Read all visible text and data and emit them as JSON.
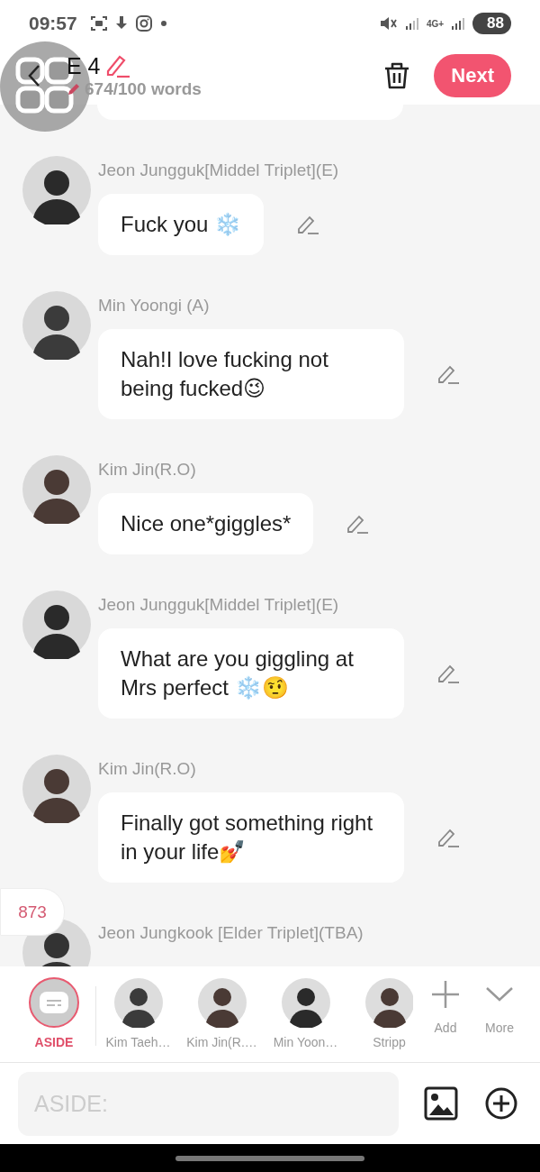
{
  "status_bar": {
    "time": "09:57",
    "network": "4G+",
    "battery": "88"
  },
  "header": {
    "title": "E 4",
    "word_count": "674/100 words",
    "next_button": "Next"
  },
  "messages": [
    {
      "speaker": "Jeon Jungguk[Middel Triplet](E)",
      "text": "Fuck you ❄️"
    },
    {
      "speaker": "Min Yoongi (A)",
      "text": "Nah!I love fucking not being fucked😉"
    },
    {
      "speaker": "Kim Jin(R.O)",
      "text": "Nice one*giggles*"
    },
    {
      "speaker": "Jeon Jungguk[Middel Triplet](E)",
      "text": "What are you giggling at Mrs perfect ❄️🤨"
    },
    {
      "speaker": "Kim Jin(R.O)",
      "text": "Finally got something right in your life💅"
    },
    {
      "speaker": "Jeon Jungkook [Elder Triplet](TBA)"
    }
  ],
  "counter_badge": "873",
  "cast": [
    {
      "name": "ASIDE",
      "kind": "aside",
      "selected": true
    },
    {
      "name": "Kim Taeh…",
      "kind": "character",
      "selected": false
    },
    {
      "name": "Kim Jin(R.…",
      "kind": "character",
      "selected": false
    },
    {
      "name": "Min Yoon…",
      "kind": "character",
      "selected": false
    },
    {
      "name": "Stripp",
      "kind": "character",
      "selected": false
    }
  ],
  "cast_actions": [
    "Add",
    "More"
  ],
  "composer": {
    "placeholder": "ASIDE:"
  }
}
